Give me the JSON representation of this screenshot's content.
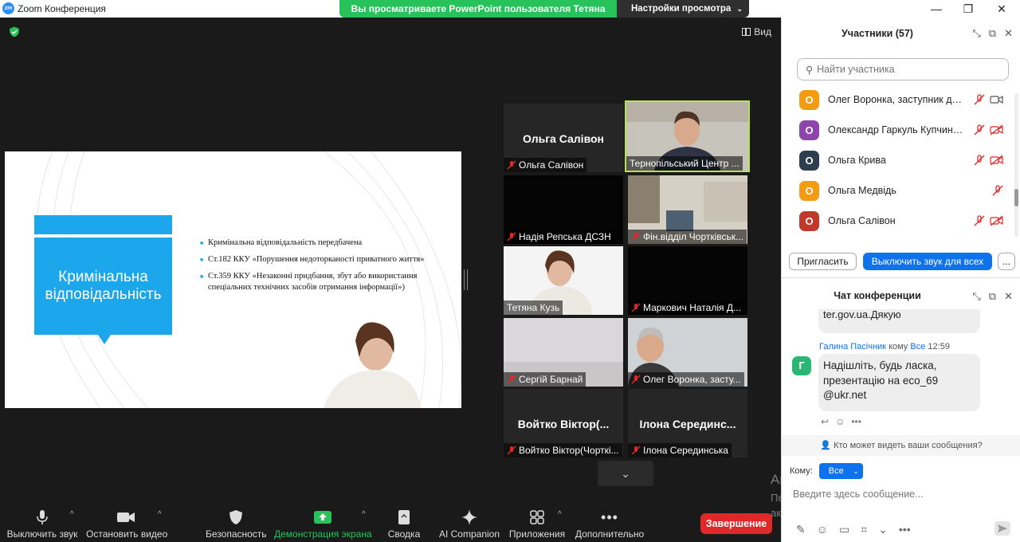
{
  "window": {
    "app_logo": "zm",
    "title": "Zoom Конференция",
    "controls": {
      "minimize": "—",
      "restore": "❐",
      "close": "✕"
    }
  },
  "share_banner": {
    "message": "Вы просматриваете PowerPoint пользователя Тетяна Кузь",
    "view_settings": "Настройки просмотра"
  },
  "view_button": "Вид",
  "slide": {
    "title_line1": "Кримінальна",
    "title_line2": "відповідальність",
    "bullets": [
      "Кримінальна відповідальність передбачена",
      "Ст.182 ККУ «Порушення недоторканості приватного життя»",
      "Ст.359 ККУ «Незаконні придбання, збут або використання спеціальних технічних засобів отримання інформації»)"
    ],
    "accent_color": "#1ca7ec"
  },
  "tiles": [
    {
      "name_big": "Ольга Салівон",
      "label": "Ольга Салівон",
      "muted": true
    },
    {
      "label": "Тернопільський Центр ...",
      "muted": false,
      "active": true
    },
    {
      "label": "Надія Репська ДСЗН",
      "muted": true
    },
    {
      "label": "Фін.відділ Чортківськ...",
      "muted": true
    },
    {
      "label": "Тетяна Кузь",
      "muted": false
    },
    {
      "label": "Маркович Наталія Д...",
      "muted": true
    },
    {
      "label": "Сергій Барнай",
      "muted": true
    },
    {
      "label": "Олег Воронка, засту...",
      "muted": true
    },
    {
      "name_big": "Войтко Віктор(...",
      "label": "Войтко Віктор(Чорткі...",
      "muted": true
    },
    {
      "name_big": "Ілона  Серединс...",
      "label": "Ілона Серединська",
      "muted": true
    }
  ],
  "toolbar": {
    "mute": "Выключить звук",
    "stop_video": "Остановить видео",
    "security": "Безопасность",
    "share_screen": "Демонстрация экрана",
    "summary": "Сводка",
    "ai_companion": "AI Companion",
    "apps": "Приложения",
    "more": "Дополнительно",
    "end": "Завершение"
  },
  "windows_activation": {
    "title": "Активація Windows",
    "subtitle": "Перейдіть до розділу \"Настройки\", щоб активувати Windows."
  },
  "participants_panel": {
    "title": "Участники (57)",
    "search_placeholder": "Найти участника",
    "participants": [
      {
        "initial": "О",
        "name": "Олег Воронка, заступник дире...",
        "color": "#f39c12",
        "video_on": true
      },
      {
        "initial": "О",
        "name": "Олександр Гаркуль Купчинец...",
        "color": "#8e44ad",
        "video_on": false
      },
      {
        "initial": "О",
        "name": "Ольга Крива",
        "color": "#2c3e50",
        "video_on": false
      },
      {
        "initial": "О",
        "name": "Ольга Медвідь",
        "color": "#f39c12",
        "video_on": null
      },
      {
        "initial": "О",
        "name": "Ольга Салівон",
        "color": "#c0392b",
        "video_on": false
      }
    ],
    "invite": "Пригласить",
    "mute_all": "Выключить звук для всех",
    "more": "..."
  },
  "chat_panel": {
    "title": "Чат конференции",
    "prev_message_tail": "ter.gov.ua.Дякую",
    "message": {
      "sender": "Галина Пасічник",
      "to_word": "кому",
      "to": "Все",
      "time": "12:59",
      "avatar_initial": "Г",
      "text_line1": "Надішліть, будь ласка,",
      "text_line2": "презентацію на eco_69",
      "text_line3": "@ukr.net"
    },
    "who_sees": "Кто может видеть ваши сообщения?",
    "to_label": "Кому:",
    "to_value": "Все",
    "input_placeholder": "Введите здесь сообщение..."
  }
}
